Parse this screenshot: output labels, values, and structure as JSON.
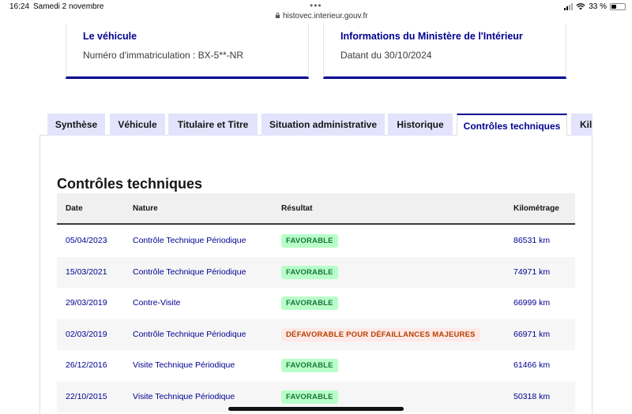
{
  "status_bar": {
    "time": "16:24",
    "date": "Samedi 2 novembre",
    "url": "histovec.interieur.gouv.fr",
    "battery": "33 %"
  },
  "cards": [
    {
      "title": "Le véhicule",
      "subtitle": "Numéro d'immatriculation : BX-5**-NR"
    },
    {
      "title": "Informations du Ministère de l'Intérieur",
      "subtitle": "Datant du 30/10/2024"
    }
  ],
  "tabs": [
    {
      "label": "Synthèse"
    },
    {
      "label": "Véhicule"
    },
    {
      "label": "Titulaire et Titre"
    },
    {
      "label": "Situation administrative"
    },
    {
      "label": "Historique"
    },
    {
      "label": "Contrôles techniques",
      "active": true
    },
    {
      "label": "Kilo"
    }
  ],
  "section_title": "Contrôles techniques",
  "table": {
    "headers": {
      "date": "Date",
      "nature": "Nature",
      "result": "Résultat",
      "km": "Kilométrage"
    },
    "rows": [
      {
        "date": "05/04/2023",
        "nature": "Contrôle Technique Périodique",
        "result": "FAVORABLE",
        "result_type": "favorable",
        "km": "86531 km"
      },
      {
        "date": "15/03/2021",
        "nature": "Contrôle Technique Périodique",
        "result": "FAVORABLE",
        "result_type": "favorable",
        "km": "74971 km"
      },
      {
        "date": "29/03/2019",
        "nature": "Contre-Visite",
        "result": "FAVORABLE",
        "result_type": "favorable",
        "km": "66999 km"
      },
      {
        "date": "02/03/2019",
        "nature": "Contrôle Technique Périodique",
        "result": "DÉFAVORABLE POUR DÉFAILLANCES MAJEURES",
        "result_type": "defavorable",
        "km": "66971 km"
      },
      {
        "date": "26/12/2016",
        "nature": "Visite Technique Périodique",
        "result": "FAVORABLE",
        "result_type": "favorable",
        "km": "61466 km"
      },
      {
        "date": "22/10/2015",
        "nature": "Visite Technique Périodique",
        "result": "FAVORABLE",
        "result_type": "favorable",
        "km": "50318 km"
      }
    ]
  },
  "colors": {
    "primary": "#000091",
    "favorable_bg": "#b8fec9",
    "favorable_text": "#18753c",
    "defavorable_bg": "#ffe9e6",
    "defavorable_text": "#b34000",
    "tab_bg": "#e3e3fd"
  }
}
